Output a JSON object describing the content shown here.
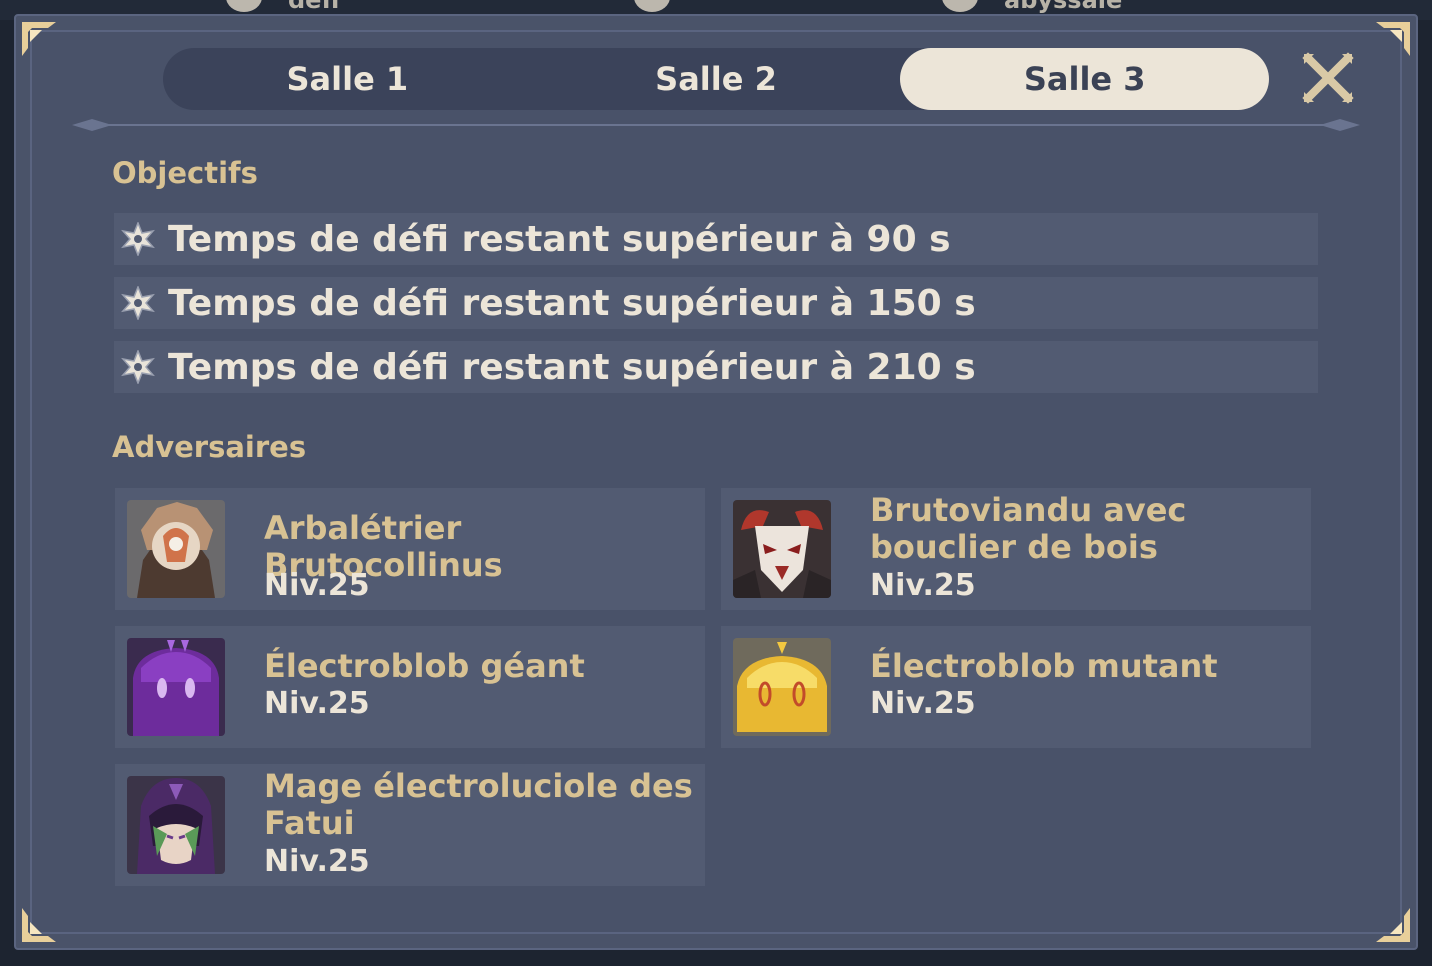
{
  "background": {
    "ghost_left": "défi",
    "ghost_right": "abyssale"
  },
  "tabs": [
    {
      "label": "Salle 1",
      "active": false
    },
    {
      "label": "Salle 2",
      "active": false
    },
    {
      "label": "Salle 3",
      "active": true
    }
  ],
  "objectives": {
    "title": "Objectifs",
    "items": [
      {
        "text": "Temps de défi restant supérieur à 90 s"
      },
      {
        "text": "Temps de défi restant supérieur à 150 s"
      },
      {
        "text": "Temps de défi restant supérieur à 210 s"
      }
    ]
  },
  "enemies": {
    "title": "Adversaires",
    "items": [
      {
        "name": "Arbalétrier Brutocollinus",
        "level": "Niv.25",
        "icon": "hilichurl-crossbow-icon"
      },
      {
        "name": "Brutoviandu avec bouclier de bois",
        "level": "Niv.25",
        "icon": "mitachurl-wooden-shield-icon"
      },
      {
        "name": "Électroblob géant",
        "level": "Niv.25",
        "icon": "large-electro-slime-icon"
      },
      {
        "name": "Électroblob mutant",
        "level": "Niv.25",
        "icon": "mutant-electro-slime-icon"
      },
      {
        "name": "Mage électroluciole des Fatui",
        "level": "Niv.25",
        "icon": "fatui-electro-cicin-mage-icon"
      }
    ]
  },
  "colors": {
    "panel": "#495269",
    "row": "#525b72",
    "gold_text": "#d8c293",
    "light_text": "#ece5d8",
    "active_tab": "#ece5d8"
  }
}
